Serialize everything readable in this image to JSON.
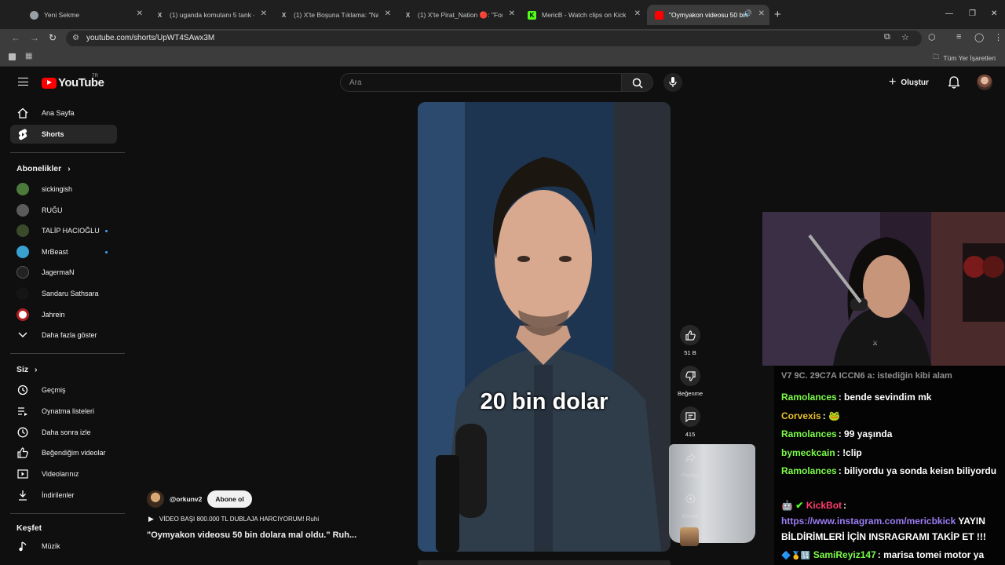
{
  "browser": {
    "tabs": [
      {
        "title": "Yeni Sekme",
        "icon": "chrome-icon",
        "color": "#9aa0a6"
      },
      {
        "title": "(1) uganda komutanı 5 tank - A",
        "icon": "x-logo-icon",
        "color": "#ffffff"
      },
      {
        "title": "(1) X'te Boşuna Tıklama: \"Nakit",
        "icon": "x-logo-icon",
        "color": "#ffffff"
      },
      {
        "title": "(1) X'te Pirat_Nation 🔴: \"Forms",
        "icon": "x-logo-icon",
        "color": "#ffffff"
      },
      {
        "title": "MericB - Watch clips on Kick",
        "icon": "kick-icon",
        "color": "#53fc18"
      },
      {
        "title": "\"Oymyakon videosu 50 bin",
        "icon": "youtube-icon",
        "color": "#ff0000",
        "active": true
      }
    ],
    "url": "youtube.com/shorts/UpWT4SAwx3M",
    "bookmarks_all": "Tüm Yer İşaretleri"
  },
  "youtube": {
    "logo_text": "YouTube",
    "country_code": "TR",
    "search_placeholder": "Ara",
    "create_label": "Oluştur"
  },
  "sidebar": {
    "main": [
      {
        "label": "Ana Sayfa",
        "icon": "home-icon"
      },
      {
        "label": "Shorts",
        "icon": "shorts-icon",
        "active": true
      }
    ],
    "subscriptions_header": "Abonelikler",
    "subscriptions": [
      {
        "label": "sickingish",
        "color": "#4c7a3a",
        "dot": false
      },
      {
        "label": "RUĞU",
        "color": "#5b5b5b",
        "dot": false
      },
      {
        "label": "TALİP HACIOĞLU",
        "color": "#3a4a2a",
        "dot": true
      },
      {
        "label": "MrBeast",
        "color": "#3aa0d0",
        "dot": true
      },
      {
        "label": "JagermaN",
        "color": "#222222",
        "dot": false
      },
      {
        "label": "Sandaru Sathsara",
        "color": "#151515",
        "dot": false
      },
      {
        "label": "Jahrein",
        "color": "#b02020",
        "dot": false
      }
    ],
    "show_more": "Daha fazla göster",
    "you_header": "Siz",
    "you": [
      {
        "label": "Geçmiş",
        "icon": "history-icon"
      },
      {
        "label": "Oynatma listeleri",
        "icon": "playlist-icon"
      },
      {
        "label": "Daha sonra izle",
        "icon": "clock-icon"
      },
      {
        "label": "Beğendiğim videolar",
        "icon": "like-icon"
      },
      {
        "label": "Videolarınız",
        "icon": "video-icon"
      },
      {
        "label": "İndirilenler",
        "icon": "download-icon"
      }
    ],
    "explore_header": "Keşfet",
    "explore": [
      {
        "label": "Müzik",
        "icon": "music-icon"
      }
    ]
  },
  "short": {
    "caption": "20 bin dolar",
    "likes": "51 B",
    "dislike_label": "Beğenme",
    "comments": "415",
    "share_label": "Paylaş",
    "remix_label": "Remix",
    "channel": "@orkunv2",
    "subscribe_label": "Abone ol",
    "music": "VİDEO BAŞI 800.000 TL DUBLAJA HARCIYORUM! Ruhi",
    "title": "\"Oymyakon videosu 50 bin dolara mal oldu.\" Ruh..."
  },
  "chat": {
    "partial_top": "V7 9C. 29C7A ICCN6 a: istediğin kibi alam",
    "messages": [
      {
        "user": "Ramolances",
        "color": "#7cfc4a",
        "text": "bende sevindim mk"
      },
      {
        "user": "Corvexis",
        "color": "#e6c02a",
        "text": "🐸"
      },
      {
        "user": "Ramolances",
        "color": "#7cfc4a",
        "text": "99 yaşında"
      },
      {
        "user": "bymeckcain",
        "color": "#7cfc4a",
        "text": "!clip"
      },
      {
        "user": "Ramolances",
        "color": "#7cfc4a",
        "text": "biliyordu ya sonda keisn biliyordu"
      },
      {
        "user": "KickBot",
        "color": "#ff3d6b",
        "text": ""
      },
      {
        "user": "SamiReyiz147",
        "color": "#7cfc4a",
        "text": "marisa tomei motor ya"
      }
    ],
    "kickbot_link": "https://www.instagram.com/mericbkick",
    "kickbot_text": "YAYIN BİLDİRİMLERİ İÇİN INSRAGRAMI TAKİP ET !!!"
  }
}
